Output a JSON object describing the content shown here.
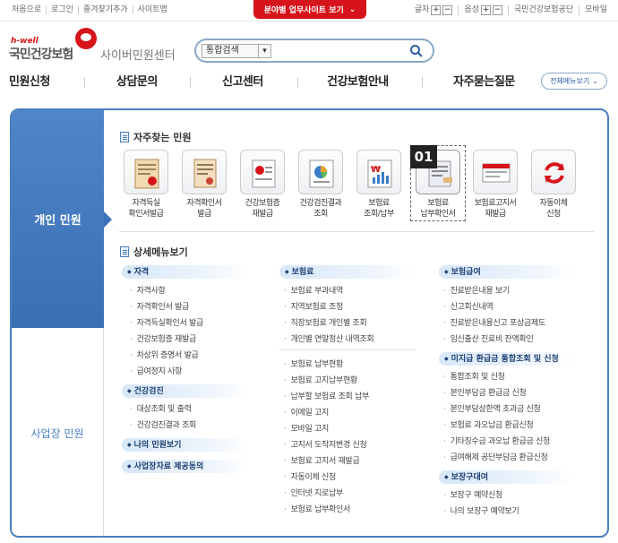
{
  "top_links": [
    "처음으로",
    "로그인",
    "즐겨찾기추가",
    "사이트맵"
  ],
  "top_tab": "분야별 업무사이트 보기",
  "font_size_label": "글자",
  "sound_label": "음성",
  "right_links": [
    "국민건강보험공단",
    "모바일"
  ],
  "logo": {
    "top": "h-well",
    "main": "국민건강보험",
    "sub": "사이버민원센터"
  },
  "search": {
    "scope": "통합검색",
    "value": ""
  },
  "nav": [
    "민원신청",
    "상담문의",
    "신고센터",
    "건강보험안내",
    "자주묻는질문"
  ],
  "all_menu": "전체메뉴보기",
  "side": {
    "personal": "개인 민원",
    "business": "사업장 민원"
  },
  "favorites_title": "자주찾는 민원",
  "favorites": [
    {
      "label": "자격득실\n확인서발급",
      "icon": "qualification-doc-icon"
    },
    {
      "label": "자격확인서\n발급",
      "icon": "certificate-icon"
    },
    {
      "label": "건강보험증\n재발급",
      "icon": "insurance-card-icon"
    },
    {
      "label": "건강검진결과\n조회",
      "icon": "checkup-chart-icon"
    },
    {
      "label": "보험료\n조회/납부",
      "icon": "premium-chart-icon"
    },
    {
      "label": "보험료\n납부확인서",
      "icon": "payment-receipt-icon"
    },
    {
      "label": "보험료고지서\n재발급",
      "icon": "bill-icon"
    },
    {
      "label": "자동이체\n신청",
      "icon": "auto-transfer-icon"
    }
  ],
  "selected_badge": "01",
  "detail_title": "상세메뉴보기",
  "col1": {
    "cat1": "자격",
    "items1": [
      "자격사항",
      "자격확인서 발급",
      "자격득실확인서 발급",
      "건강보험증 재발급",
      "차상위 증명서 발급",
      "급여정지 사항"
    ],
    "cat2": "건강검진",
    "items2": [
      "대상조회 및 출력",
      "건강검진결과 조회"
    ],
    "cat3": "나의 민원보기",
    "cat4": "사업장자료 제공동의"
  },
  "col2": {
    "cat1": "보험료",
    "items1": [
      "보험료 부과내역",
      "지역보험료 조정",
      "직장보험료 개인별 조회",
      "개인별 연말정산 내역조회"
    ],
    "items2": [
      "보험료 납부현황",
      "보험료 고지납부현황",
      "납부할 보험료 조회 납부",
      "이메일 고지",
      "모바일 고지",
      "고지서 도착지변경 신청",
      "보험료 고지서 재발급",
      "자동이체 신청",
      "인터넷 지로납부",
      "보험료 납부확인서"
    ]
  },
  "col3": {
    "cat1": "보험급여",
    "items1": [
      "진료받은내용 보기",
      "신고회신내역",
      "진료받은내용신고 포상금제도",
      "임신출산 진료비 잔액확인"
    ],
    "cat2": "미지급 환급금 통합조회 및 신청",
    "items2": [
      "통합조회 및 신청",
      "본인부담금 환급금 신청",
      "본인부담상한액 초과금 신청",
      "보험료 과오납금 환급신청",
      "기타징수금 과오납 환급금 신청",
      "급여해제 공단부담금 환급신청"
    ],
    "cat3": "보장구대여",
    "items3": [
      "보장구 예약신청",
      "나의 보장구 예약보기"
    ]
  }
}
